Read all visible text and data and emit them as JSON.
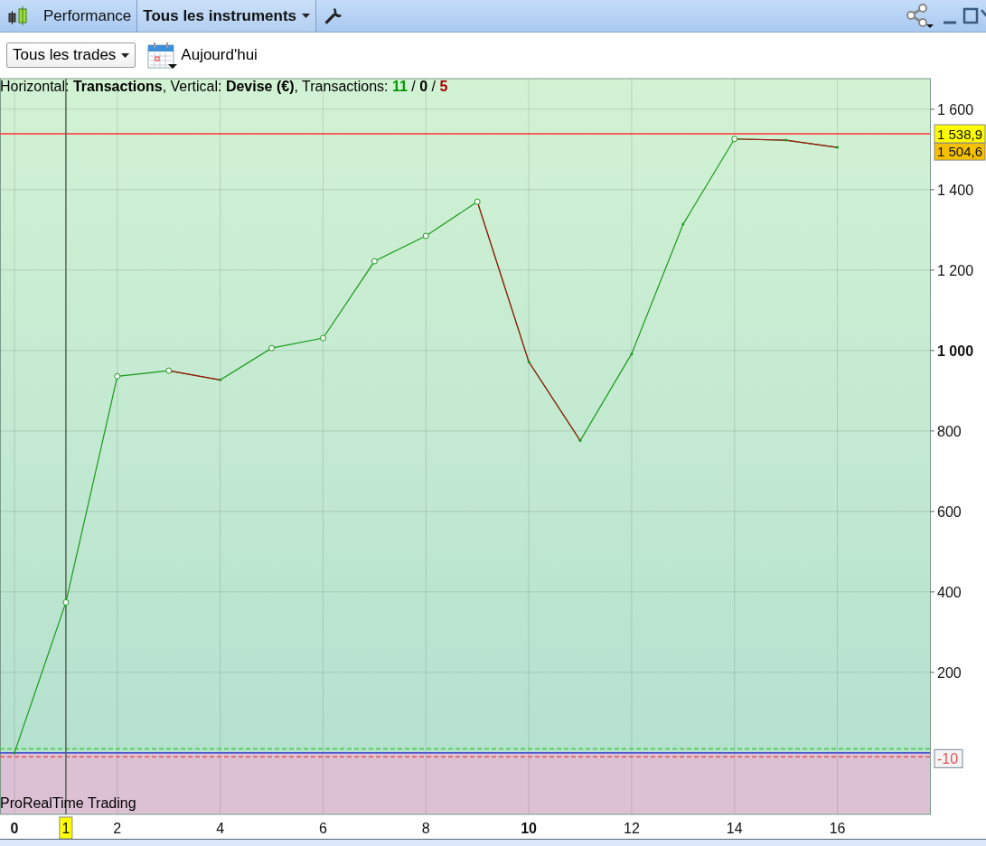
{
  "title_bar": {
    "tabs": [
      {
        "label": "Performance",
        "selected": false,
        "dropdown": false
      },
      {
        "label": "Tous les instruments",
        "selected": true,
        "dropdown": true
      }
    ]
  },
  "toolbar": {
    "filter": "Tous les trades",
    "date": "Aujourd'hui"
  },
  "chart": {
    "caption": "Horizontal: **Transactions**, Vertical: **Devise (€)**, Transactions: ",
    "counts": [
      {
        "text": "11",
        "color": "#009900"
      },
      {
        "text": "0",
        "color": "#000000"
      },
      {
        "text": "5",
        "color": "#aa0000"
      }
    ],
    "separator": "/",
    "footer_label": "ProRealTime Trading",
    "x_tick_bold": [
      true,
      false,
      false,
      false,
      false,
      true,
      false,
      false,
      false
    ],
    "y_tick_bold": [
      false,
      false,
      false,
      true,
      false,
      false,
      false,
      false
    ],
    "markers": [
      false,
      true,
      true,
      true,
      false,
      true,
      true,
      true,
      true,
      true,
      false,
      false,
      false,
      false,
      true,
      false,
      false
    ],
    "last_value_tag": "1 504,6",
    "ref_line_dashed": [
      false,
      true,
      false,
      true,
      false
    ],
    "chart_data": {
      "type": "line",
      "grid": true,
      "x": [
        0,
        1,
        2,
        3,
        4,
        5,
        6,
        7,
        8,
        9,
        10,
        11,
        12,
        13,
        14,
        15,
        16
      ],
      "series": [
        {
          "color": "#1a9a1a",
          "values": [
            0,
            374,
            936,
            950,
            927,
            1006,
            1031,
            1222,
            1285,
            1370,
            972,
            776,
            992,
            1314,
            1526,
            1523,
            1505
          ]
        },
        {
          "color": "#aa1111",
          "values": [
            null,
            null,
            null,
            950,
            927,
            null,
            null,
            null,
            null,
            1370,
            972,
            776,
            null,
            null,
            1526,
            1523,
            1505
          ]
        }
      ],
      "xlim": [
        0,
        17.8
      ],
      "ylim": [
        -153,
        1676
      ],
      "xticks": [
        {
          "value": 0,
          "label": "0"
        },
        {
          "value": 2,
          "label": "2"
        },
        {
          "value": 4,
          "label": "4"
        },
        {
          "value": 6,
          "label": "6"
        },
        {
          "value": 8,
          "label": "8"
        },
        {
          "value": 10,
          "label": "10"
        },
        {
          "value": 12,
          "label": "12"
        },
        {
          "value": 14,
          "label": "14"
        },
        {
          "value": 16,
          "label": "16"
        }
      ],
      "yticks": [
        {
          "value": 1600,
          "label": "1 600"
        },
        {
          "value": 1400,
          "label": "1 400"
        },
        {
          "value": 1200,
          "label": "1 200"
        },
        {
          "value": 1000,
          "label": "1 000"
        },
        {
          "value": 800,
          "label": "800"
        },
        {
          "value": 600,
          "label": "600"
        },
        {
          "value": 400,
          "label": "400"
        },
        {
          "value": 200,
          "label": "200"
        }
      ],
      "ref_lines": [
        {
          "axis": "y",
          "value": 1538.9,
          "label": "1 538,9",
          "color": "#ff3333"
        },
        {
          "axis": "y",
          "value": 10,
          "color": "#44cc44"
        },
        {
          "axis": "y",
          "value": 0,
          "color": "#3344cc"
        },
        {
          "axis": "y",
          "value": -10,
          "label": "-10",
          "color": "#e05555"
        },
        {
          "axis": "x",
          "value": 1,
          "label": "1",
          "color": "#556655"
        }
      ]
    }
  }
}
